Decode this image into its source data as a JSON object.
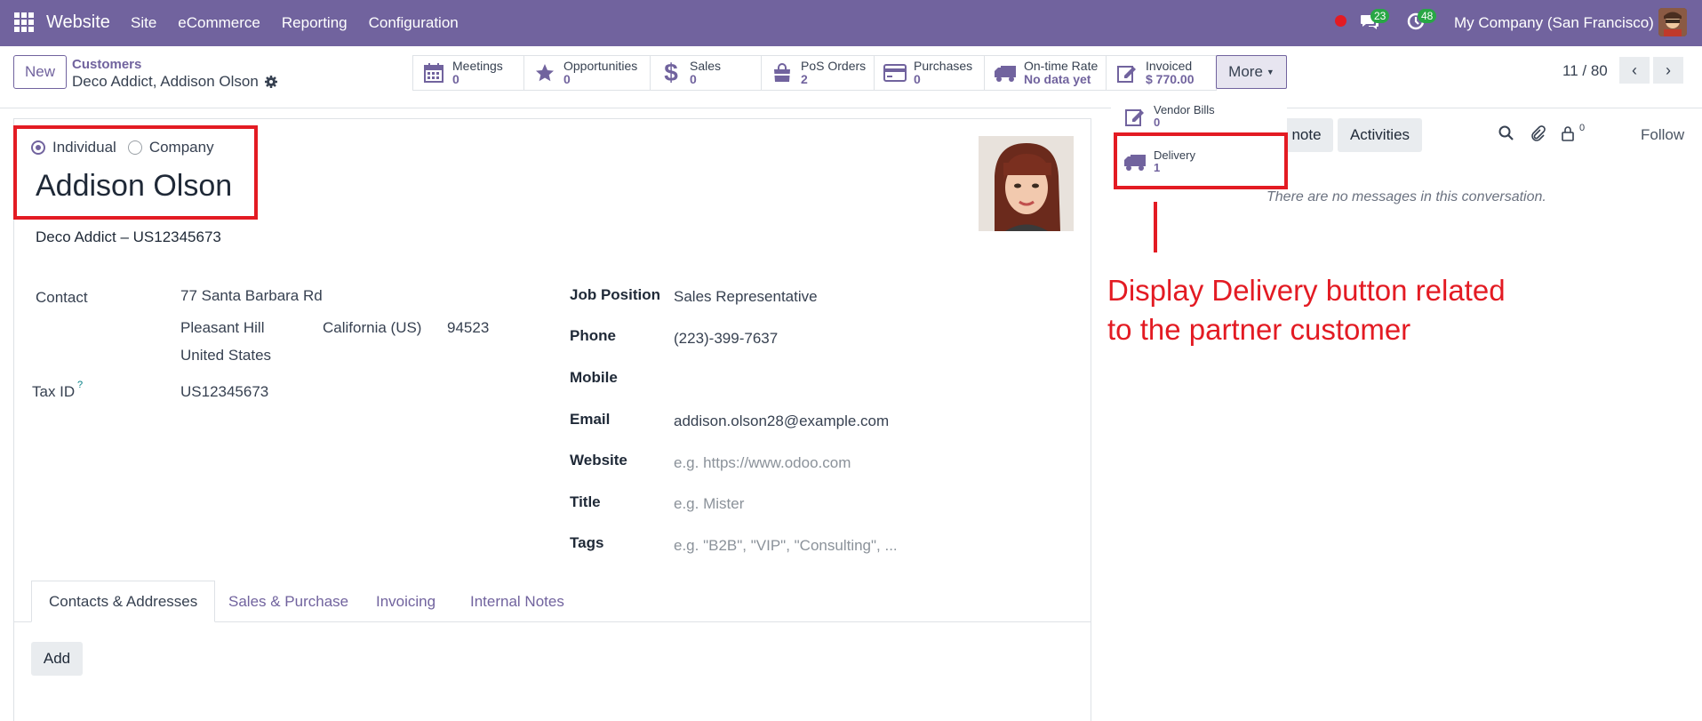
{
  "navbar": {
    "brand": "Website",
    "menu": [
      "Site",
      "eCommerce",
      "Reporting",
      "Configuration"
    ],
    "messages_count": "23",
    "activities_count": "48",
    "company": "My Company (San Francisco)"
  },
  "control": {
    "new_label": "New",
    "breadcrumb_parent": "Customers",
    "breadcrumb_current": "Deco Addict, Addison Olson",
    "stats": [
      {
        "label": "Meetings",
        "value": "0",
        "icon": "calendar-icon"
      },
      {
        "label": "Opportunities",
        "value": "0",
        "icon": "star-icon"
      },
      {
        "label": "Sales",
        "value": "0",
        "icon": "dollar-icon"
      },
      {
        "label": "PoS Orders",
        "value": "2",
        "icon": "shopping-bag-icon"
      },
      {
        "label": "Purchases",
        "value": "0",
        "icon": "credit-card-icon"
      },
      {
        "label": "On-time Rate",
        "value": "No data yet",
        "icon": "truck-icon"
      },
      {
        "label": "Invoiced",
        "value": "$ 770.00",
        "icon": "edit-icon"
      }
    ],
    "more_label": "More",
    "pager": "11 / 80"
  },
  "more_menu": [
    {
      "label": "Vendor Bills",
      "value": "0",
      "icon": "edit-icon"
    },
    {
      "label": "Delivery",
      "value": "1",
      "icon": "truck-icon"
    }
  ],
  "form": {
    "type_individual": "Individual",
    "type_company": "Company",
    "name": "Addison Olson",
    "parent": "Deco Addict – US12345673",
    "contact_label": "Contact",
    "street": "77 Santa Barbara Rd",
    "city": "Pleasant Hill",
    "state": "California (US)",
    "zip": "94523",
    "country": "United States",
    "tax_label": "Tax ID",
    "tax_help": "?",
    "tax_value": "US12345673",
    "job_label": "Job Position",
    "job_value": "Sales Representative",
    "phone_label": "Phone",
    "phone_value": "(223)-399-7637",
    "mobile_label": "Mobile",
    "email_label": "Email",
    "email_value": "addison.olson28@example.com",
    "website_label": "Website",
    "website_placeholder": "e.g. https://www.odoo.com",
    "title_label": "Title",
    "title_placeholder": "e.g. Mister",
    "tags_label": "Tags",
    "tags_placeholder": "e.g. \"B2B\", \"VIP\", \"Consulting\", ...",
    "tabs": [
      "Contacts & Addresses",
      "Sales & Purchase",
      "Invoicing",
      "Internal Notes"
    ],
    "add_label": "Add"
  },
  "chatter": {
    "log_note": "note",
    "activities": "Activities",
    "followers_count": "0",
    "follow": "Follow",
    "empty": "There are no messages in this conversation."
  },
  "annotation": {
    "text_line1": "Display Delivery button related",
    "text_line2": "to the partner customer",
    "color": "#e31b23"
  },
  "colors": {
    "brand": "#71639e",
    "badge": "#28a745"
  }
}
